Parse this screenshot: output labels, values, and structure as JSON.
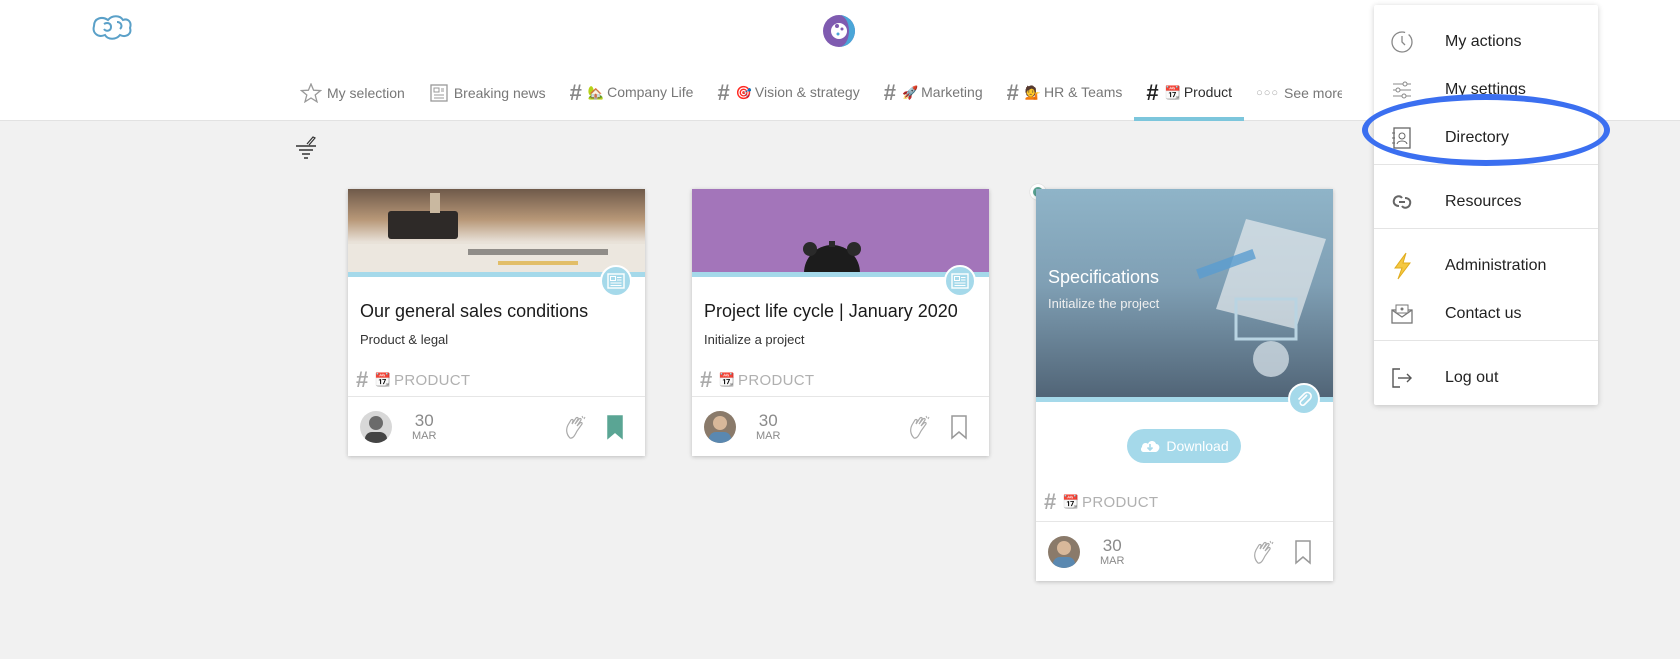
{
  "nav": {
    "items": [
      {
        "label": "My selection"
      },
      {
        "label": "Breaking news"
      },
      {
        "label": "Company Life",
        "emoji": "🏡"
      },
      {
        "label": "Vision & strategy",
        "emoji": "🎯"
      },
      {
        "label": "Marketing",
        "emoji": "🚀"
      },
      {
        "label": "HR & Teams",
        "emoji": "💁"
      },
      {
        "label": "Product",
        "emoji": "📆"
      },
      {
        "label": "See more"
      }
    ]
  },
  "cards": [
    {
      "title": "Our general sales conditions",
      "subtitle": "Product & legal",
      "tag": "PRODUCT",
      "date_day": "30",
      "date_month": "MAR",
      "bookmarked": true
    },
    {
      "title": "Project life cycle | January 2020",
      "subtitle": "Initialize a project",
      "tag": "PRODUCT",
      "date_day": "30",
      "date_month": "MAR",
      "bookmarked": false
    },
    {
      "title": "Specifications",
      "subtitle": "Initialize the project",
      "button": "Download",
      "tag": "PRODUCT",
      "date_day": "30",
      "date_month": "MAR",
      "bookmarked": false
    }
  ],
  "menu": {
    "items": [
      {
        "label": "My actions",
        "icon": "clock-icon"
      },
      {
        "label": "My settings",
        "icon": "sliders-icon"
      },
      {
        "label": "Directory",
        "icon": "contact-book-icon"
      },
      {
        "label": "Resources",
        "icon": "link-icon"
      },
      {
        "label": "Administration",
        "icon": "lightning-icon"
      },
      {
        "label": "Contact us",
        "icon": "envelope-icon"
      },
      {
        "label": "Log out",
        "icon": "logout-icon"
      }
    ]
  },
  "colors": {
    "accent": "#a5d9ea",
    "highlight": "#3b6ff0",
    "bookmark_active": "#5aa594"
  }
}
